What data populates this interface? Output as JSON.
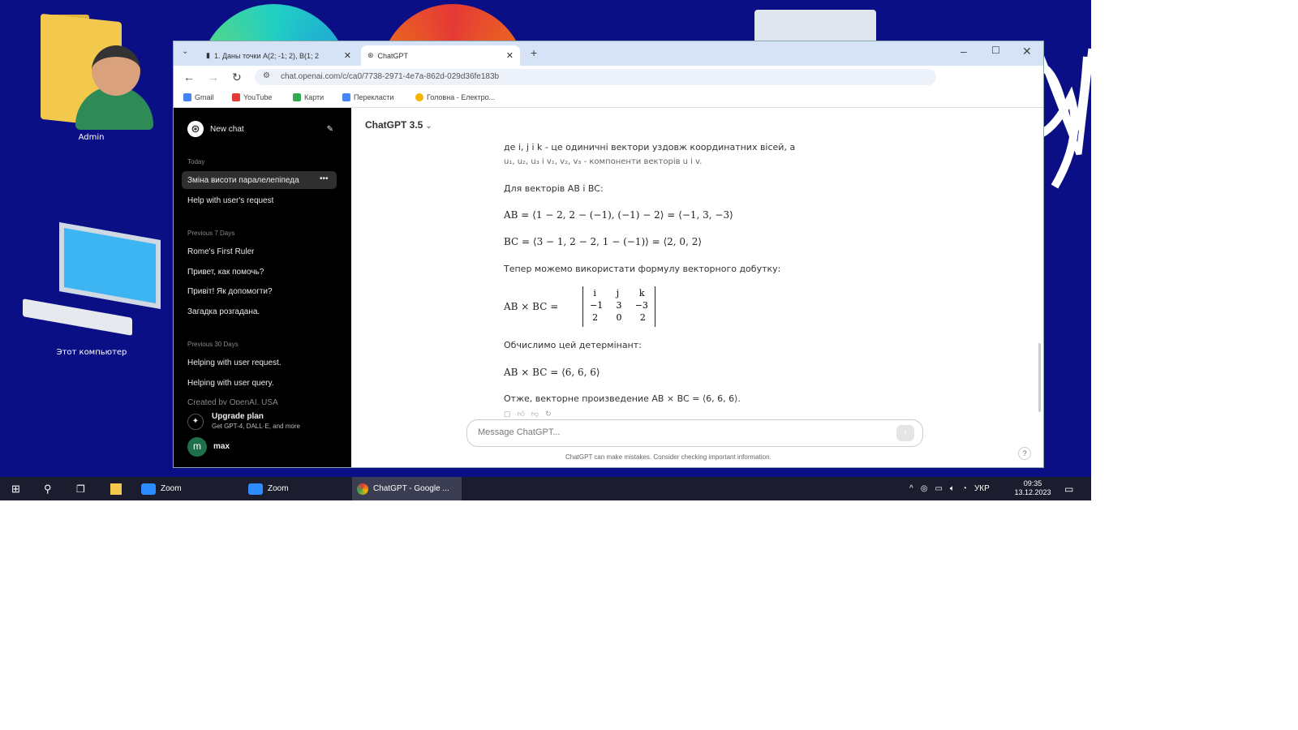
{
  "desktop": {
    "icons": [
      {
        "label": "Admin"
      },
      {
        "label": "Этот компьютер"
      }
    ]
  },
  "browser": {
    "tabs": [
      {
        "label": "1. Даны точки A(2; -1; 2), B(1; 2"
      },
      {
        "label": "ChatGPT"
      }
    ],
    "url": "chat.openai.com/c/ca0/7738-2971-4e7a-862d-029d36fe183b",
    "bookmarks": [
      "Gmail",
      "YouTube",
      "Карти",
      "Перекласти",
      "Головна - Електро..."
    ]
  },
  "sidebar": {
    "new_chat": "New chat",
    "sections": [
      {
        "header": "Today",
        "items": [
          "Зміна висоти паралелепіпеда",
          "Help with user's request"
        ]
      },
      {
        "header": "Previous 7 Days",
        "items": [
          "Rome's First Ruler",
          "Привет, как помочь?",
          "Привіт! Як допомогти?",
          "Загадка розгадана."
        ]
      },
      {
        "header": "Previous 30 Days",
        "items": [
          "Helping with user request.",
          "Helping with user query.",
          "Created by OpenAI. USA"
        ]
      }
    ],
    "upgrade_title": "Upgrade plan",
    "upgrade_subtitle": "Get GPT-4, DALL·E, and more",
    "user_initial": "m",
    "user_name": "max"
  },
  "main": {
    "model": "ChatGPT 3.5",
    "lines": {
      "l1": "де i, j і k - це одиничні вектори уздовж координатних вісей, а",
      "l2": "u₁, u₂, u₃ і v₁, v₂, v₃ - компоненти векторів u і v.",
      "l3": "Для векторів AB і BC:",
      "l4": "AB = ⟨1 − 2, 2 − (−1), (−1) − 2⟩ = ⟨−1, 3, −3⟩",
      "l5": "BC = ⟨3 − 1, 2 − 2, 1 − (−1)⟩ = ⟨2, 0, 2⟩",
      "l6": "Тепер можемо використати формулу векторного добутку:",
      "l7": "AB × BC =",
      "l8": "Обчислимо цей детермінант:",
      "l9": "AB × BC = ⟨6, 6, 6⟩",
      "l10": "Отже, векторне произведение AB × BC = ⟨6, 6, 6⟩."
    },
    "det_rows": [
      [
        "i",
        "j",
        "k"
      ],
      [
        "−1",
        "3",
        "−3"
      ],
      [
        "2",
        "0",
        "2"
      ]
    ],
    "composer_placeholder": "Message ChatGPT...",
    "disclaimer": "ChatGPT can make mistakes. Consider checking important information.",
    "help": "?"
  },
  "taskbar": {
    "apps": [
      "Zoom",
      "Zoom",
      "ChatGPT - Google ..."
    ],
    "lang": "УКР",
    "time": "09:35",
    "date": "13.12.2023"
  },
  "colors": {
    "desktop_bg": "#0b0f86",
    "sidebar_bg": "#000000",
    "tabbar_bg": "#d6e3f7"
  }
}
